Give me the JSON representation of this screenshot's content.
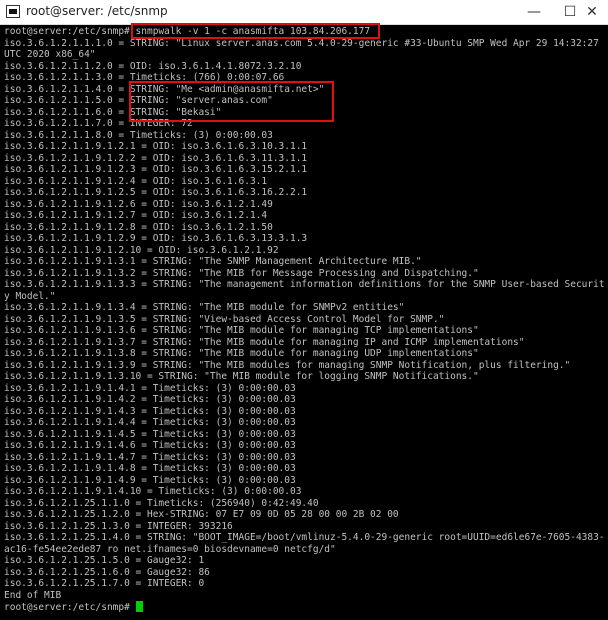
{
  "window": {
    "title": "root@server: /etc/snmp",
    "min_glyph": "—",
    "max_glyph": "☐",
    "close_glyph": "✕"
  },
  "terminal": {
    "lines": [
      "root@server:/etc/snmp# snmpwalk -v 1 -c anasmifta 103.84.206.177",
      "iso.3.6.1.2.1.1.1.0 = STRING: \"Linux server.anas.com 5.4.0-29-generic #33-Ubuntu SMP Wed Apr 29 14:32:27",
      "UTC 2020 x86_64\"",
      "iso.3.6.1.2.1.1.2.0 = OID: iso.3.6.1.4.1.8072.3.2.10",
      "iso.3.6.1.2.1.1.3.0 = Timeticks: (766) 0:00:07.66",
      "iso.3.6.1.2.1.1.4.0 = STRING: \"Me <admin@anasmifta.net>\"",
      "iso.3.6.1.2.1.1.5.0 = STRING: \"server.anas.com\"",
      "iso.3.6.1.2.1.1.6.0 = STRING: \"Bekasi\"",
      "iso.3.6.1.2.1.1.7.0 = INTEGER: 72",
      "iso.3.6.1.2.1.1.8.0 = Timeticks: (3) 0:00:00.03",
      "iso.3.6.1.2.1.1.9.1.2.1 = OID: iso.3.6.1.6.3.10.3.1.1",
      "iso.3.6.1.2.1.1.9.1.2.2 = OID: iso.3.6.1.6.3.11.3.1.1",
      "iso.3.6.1.2.1.1.9.1.2.3 = OID: iso.3.6.1.6.3.15.2.1.1",
      "iso.3.6.1.2.1.1.9.1.2.4 = OID: iso.3.6.1.6.3.1",
      "iso.3.6.1.2.1.1.9.1.2.5 = OID: iso.3.6.1.6.3.16.2.2.1",
      "iso.3.6.1.2.1.1.9.1.2.6 = OID: iso.3.6.1.2.1.49",
      "iso.3.6.1.2.1.1.9.1.2.7 = OID: iso.3.6.1.2.1.4",
      "iso.3.6.1.2.1.1.9.1.2.8 = OID: iso.3.6.1.2.1.50",
      "iso.3.6.1.2.1.1.9.1.2.9 = OID: iso.3.6.1.6.3.13.3.1.3",
      "iso.3.6.1.2.1.1.9.1.2.10 = OID: iso.3.6.1.2.1.92",
      "iso.3.6.1.2.1.1.9.1.3.1 = STRING: \"The SNMP Management Architecture MIB.\"",
      "iso.3.6.1.2.1.1.9.1.3.2 = STRING: \"The MIB for Message Processing and Dispatching.\"",
      "iso.3.6.1.2.1.1.9.1.3.3 = STRING: \"The management information definitions for the SNMP User-based Securit",
      "y Model.\"",
      "iso.3.6.1.2.1.1.9.1.3.4 = STRING: \"The MIB module for SNMPv2 entities\"",
      "iso.3.6.1.2.1.1.9.1.3.5 = STRING: \"View-based Access Control Model for SNMP.\"",
      "iso.3.6.1.2.1.1.9.1.3.6 = STRING: \"The MIB module for managing TCP implementations\"",
      "iso.3.6.1.2.1.1.9.1.3.7 = STRING: \"The MIB module for managing IP and ICMP implementations\"",
      "iso.3.6.1.2.1.1.9.1.3.8 = STRING: \"The MIB module for managing UDP implementations\"",
      "iso.3.6.1.2.1.1.9.1.3.9 = STRING: \"The MIB modules for managing SNMP Notification, plus filtering.\"",
      "iso.3.6.1.2.1.1.9.1.3.10 = STRING: \"The MIB module for logging SNMP Notifications.\"",
      "iso.3.6.1.2.1.1.9.1.4.1 = Timeticks: (3) 0:00:00.03",
      "iso.3.6.1.2.1.1.9.1.4.2 = Timeticks: (3) 0:00:00.03",
      "iso.3.6.1.2.1.1.9.1.4.3 = Timeticks: (3) 0:00:00.03",
      "iso.3.6.1.2.1.1.9.1.4.4 = Timeticks: (3) 0:00:00.03",
      "iso.3.6.1.2.1.1.9.1.4.5 = Timeticks: (3) 0:00:00.03",
      "iso.3.6.1.2.1.1.9.1.4.6 = Timeticks: (3) 0:00:00.03",
      "iso.3.6.1.2.1.1.9.1.4.7 = Timeticks: (3) 0:00:00.03",
      "iso.3.6.1.2.1.1.9.1.4.8 = Timeticks: (3) 0:00:00.03",
      "iso.3.6.1.2.1.1.9.1.4.9 = Timeticks: (3) 0:00:00.03",
      "iso.3.6.1.2.1.1.9.1.4.10 = Timeticks: (3) 0:00:00.03",
      "iso.3.6.1.2.1.25.1.1.0 = Timeticks: (256940) 0:42:49.40",
      "iso.3.6.1.2.1.25.1.2.0 = Hex-STRING: 07 E7 09 0D 05 28 00 00 2B 02 00",
      "iso.3.6.1.2.1.25.1.3.0 = INTEGER: 393216",
      "iso.3.6.1.2.1.25.1.4.0 = STRING: \"BOOT_IMAGE=/boot/vmlinuz-5.4.0-29-generic root=UUID=ed6le67e-7605-4383-",
      "ac16-fe54ee2ede87 ro net.ifnames=0 biosdevname=0 netcfg/d\"",
      "iso.3.6.1.2.1.25.1.5.0 = Gauge32: 1",
      "iso.3.6.1.2.1.25.1.6.0 = Gauge32: 86",
      "iso.3.6.1.2.1.25.1.7.0 = INTEGER: 0",
      "End of MIB",
      "root@server:/etc/snmp# "
    ],
    "colors": {
      "background": "#000000",
      "text": "#c0c0c0",
      "cursor": "#00d000",
      "highlight": "#e01010"
    }
  }
}
